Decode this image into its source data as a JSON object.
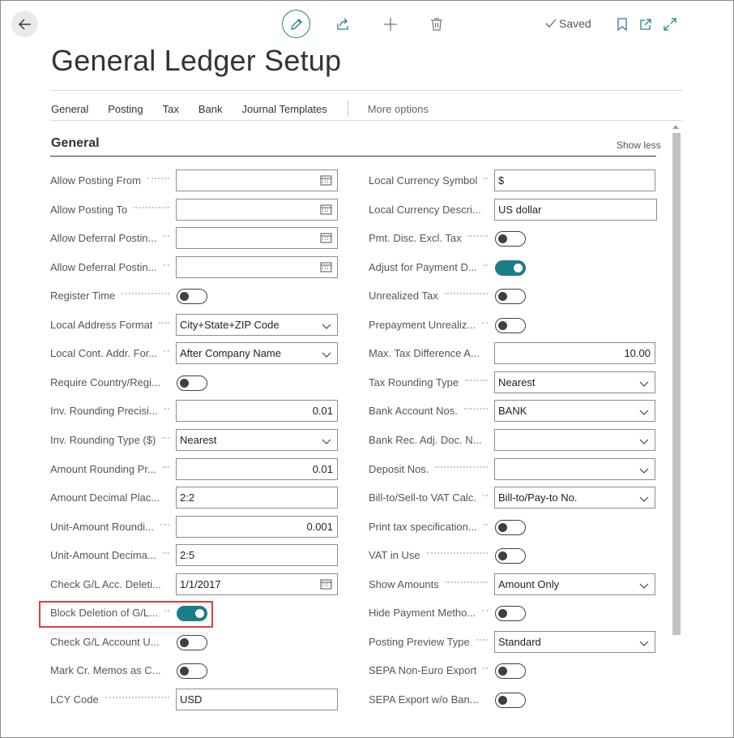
{
  "header": {
    "title": "General Ledger Setup",
    "saved_label": "Saved",
    "icons": [
      "back-arrow-icon",
      "pencil-icon",
      "share-icon",
      "plus-icon",
      "trash-icon",
      "checkmark-icon",
      "bookmark-icon",
      "open-new-window-icon",
      "expand-icon"
    ]
  },
  "tabs": [
    "General",
    "Posting",
    "Tax",
    "Bank",
    "Journal Templates"
  ],
  "more_options": "More options",
  "section": {
    "title": "General",
    "show_less": "Show less"
  },
  "left_fields": [
    {
      "label": "Allow Posting From",
      "type": "date",
      "value": ""
    },
    {
      "label": "Allow Posting To",
      "type": "date",
      "value": ""
    },
    {
      "label": "Allow Deferral Postin...",
      "type": "date",
      "value": ""
    },
    {
      "label": "Allow Deferral Postin...",
      "type": "date",
      "value": ""
    },
    {
      "label": "Register Time",
      "type": "toggle",
      "on": false
    },
    {
      "label": "Local Address Format",
      "type": "select",
      "value": "City+State+ZIP Code"
    },
    {
      "label": "Local Cont. Addr. For...",
      "type": "select",
      "value": "After Company Name"
    },
    {
      "label": "Require Country/Regi...",
      "type": "toggle",
      "on": false
    },
    {
      "label": "Inv. Rounding Precisi...",
      "type": "number",
      "value": "0.01"
    },
    {
      "label": "Inv. Rounding Type ($)",
      "type": "select",
      "value": "Nearest"
    },
    {
      "label": "Amount Rounding Pr...",
      "type": "number",
      "value": "0.01"
    },
    {
      "label": "Amount Decimal Plac...",
      "type": "text",
      "value": "2:2"
    },
    {
      "label": "Unit-Amount Roundi...",
      "type": "number",
      "value": "0.001"
    },
    {
      "label": "Unit-Amount Decima...",
      "type": "text",
      "value": "2:5"
    },
    {
      "label": "Check G/L Acc. Deleti...",
      "type": "date",
      "value": "1/1/2017"
    },
    {
      "label": "Block Deletion of G/L...",
      "type": "toggle",
      "on": true
    },
    {
      "label": "Check G/L Account U...",
      "type": "toggle",
      "on": false
    },
    {
      "label": "Mark Cr. Memos as C...",
      "type": "toggle",
      "on": false
    },
    {
      "label": "LCY Code",
      "type": "text",
      "value": "USD"
    }
  ],
  "right_fields": [
    {
      "label": "Local Currency Symbol",
      "type": "text",
      "value": "$"
    },
    {
      "label": "Local Currency Descri...",
      "type": "text",
      "value": "US dollar"
    },
    {
      "label": "Pmt. Disc. Excl. Tax",
      "type": "toggle",
      "on": false
    },
    {
      "label": "Adjust for Payment D...",
      "type": "toggle",
      "on": true
    },
    {
      "label": "Unrealized Tax",
      "type": "toggle",
      "on": false
    },
    {
      "label": "Prepayment Unrealiz...",
      "type": "toggle",
      "on": false
    },
    {
      "label": "Max. Tax Difference A...",
      "type": "number",
      "value": "10.00"
    },
    {
      "label": "Tax Rounding Type",
      "type": "select",
      "value": "Nearest"
    },
    {
      "label": "Bank Account Nos.",
      "type": "select",
      "value": "BANK"
    },
    {
      "label": "Bank Rec. Adj. Doc. N...",
      "type": "select",
      "value": ""
    },
    {
      "label": "Deposit Nos.",
      "type": "select",
      "value": ""
    },
    {
      "label": "Bill-to/Sell-to VAT Calc.",
      "type": "select",
      "value": "Bill-to/Pay-to No."
    },
    {
      "label": "Print tax specification...",
      "type": "toggle",
      "on": false
    },
    {
      "label": "VAT in Use",
      "type": "toggle",
      "on": false
    },
    {
      "label": "Show Amounts",
      "type": "select",
      "value": "Amount Only"
    },
    {
      "label": "Hide Payment Metho...",
      "type": "toggle",
      "on": false
    },
    {
      "label": "Posting Preview Type",
      "type": "select",
      "value": "Standard"
    },
    {
      "label": "SEPA Non-Euro Export",
      "type": "toggle",
      "on": false
    },
    {
      "label": "SEPA Export w/o Ban...",
      "type": "toggle",
      "on": false
    }
  ],
  "colors": {
    "accent": "#1b7e86",
    "highlight_border": "#e0403a",
    "toggle_off": "#404040"
  }
}
